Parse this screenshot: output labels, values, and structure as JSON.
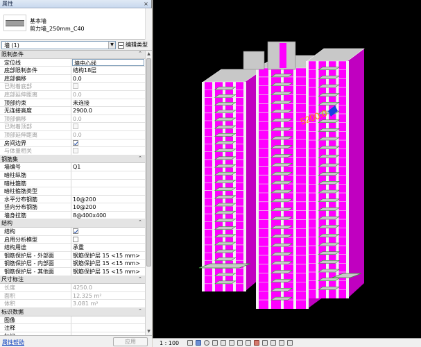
{
  "panel": {
    "title": "属性",
    "close": "×",
    "type": {
      "family": "基本墙",
      "name": "剪力墙_250mm_C40"
    },
    "selector": "墙 (1)",
    "edit_type": "编辑类型",
    "help": "属性帮助",
    "apply": "应用",
    "sections": [
      {
        "title": "限制条件",
        "rows": [
          {
            "k": "定位线",
            "v": "墙中心线",
            "editing": true
          },
          {
            "k": "底部限制条件",
            "v": "结构18层"
          },
          {
            "k": "底部偏移",
            "v": "0.0"
          },
          {
            "k": "已附着底部",
            "check": false,
            "dim": true
          },
          {
            "k": "底部延伸距离",
            "v": "0.0",
            "dim": true
          },
          {
            "k": "顶部约束",
            "v": "未连接"
          },
          {
            "k": "无连接高度",
            "v": "2900.0"
          },
          {
            "k": "顶部偏移",
            "v": "0.0",
            "dim": true
          },
          {
            "k": "已附着顶部",
            "check": false,
            "dim": true
          },
          {
            "k": "顶部延伸距离",
            "v": "0.0",
            "dim": true
          },
          {
            "k": "房间边界",
            "check": true
          },
          {
            "k": "与体量相关",
            "check": false,
            "dim": true
          }
        ]
      },
      {
        "title": "钢筋集",
        "rows": [
          {
            "k": "墙编号",
            "v": "Q1"
          },
          {
            "k": "暗柱纵筋",
            "v": ""
          },
          {
            "k": "暗柱箍筋",
            "v": ""
          },
          {
            "k": "暗柱箍筋类型",
            "v": ""
          },
          {
            "k": "水平分布钢筋",
            "v": "  10@200"
          },
          {
            "k": "竖向分布钢筋",
            "v": "  10@200"
          },
          {
            "k": "墙身拉筋",
            "v": "  8@400x400"
          }
        ]
      },
      {
        "title": "结构",
        "rows": [
          {
            "k": "结构",
            "check": true
          },
          {
            "k": "启用分析模型",
            "check": false
          },
          {
            "k": "结构用途",
            "v": "承重"
          },
          {
            "k": "钢筋保护层 - 外部面",
            "v": "钢筋保护层 15 <15 mm>"
          },
          {
            "k": "钢筋保护层 - 内部面",
            "v": "钢筋保护层 15 <15 mm>"
          },
          {
            "k": "钢筋保护层 - 其他面",
            "v": "钢筋保护层 15 <15 mm>"
          }
        ]
      },
      {
        "title": "尺寸标注",
        "rows": [
          {
            "k": "长度",
            "v": "4250.0",
            "dim": true
          },
          {
            "k": "面积",
            "v": "12.325 m²",
            "dim": true
          },
          {
            "k": "体积",
            "v": "3.081 m³",
            "dim": true
          }
        ]
      },
      {
        "title": "标识数据",
        "rows": [
          {
            "k": "图像",
            "v": ""
          },
          {
            "k": "注释",
            "v": ""
          },
          {
            "k": "标记",
            "v": ""
          }
        ]
      }
    ]
  },
  "view": {
    "annotation": "5200.0",
    "scale": "1 : 100",
    "colors": {
      "wall": "#ff00ff",
      "wall_shade": "#c000c0",
      "slab": "#c8c8c8",
      "edge": "#3c9a3c",
      "background": "#000000"
    }
  }
}
